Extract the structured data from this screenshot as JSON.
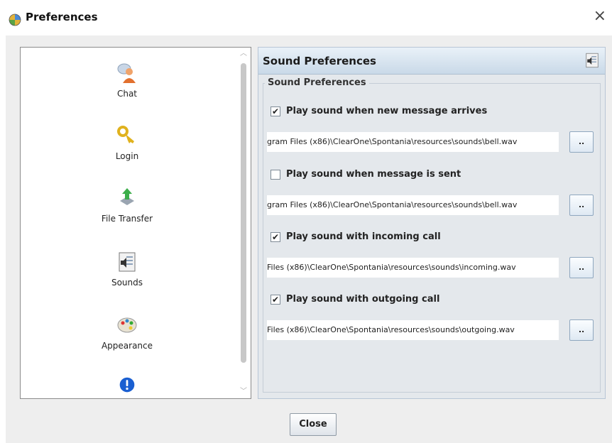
{
  "window": {
    "title": "Preferences",
    "close_glyph": "×"
  },
  "sidebar": {
    "items": [
      {
        "label": "Chat",
        "icon": "chat-user-icon"
      },
      {
        "label": "Login",
        "icon": "key-icon"
      },
      {
        "label": "File Transfer",
        "icon": "file-transfer-icon"
      },
      {
        "label": "Sounds",
        "icon": "sounds-icon"
      },
      {
        "label": "Appearance",
        "icon": "palette-icon"
      },
      {
        "label": "",
        "icon": "info-icon"
      }
    ]
  },
  "panel": {
    "header_title": "Sound Preferences",
    "group_title": "Sound Preferences",
    "options": [
      {
        "label": "Play sound when new message arrives",
        "checked": true,
        "path": "gram Files (x86)\\ClearOne\\Spontania\\resources\\sounds\\bell.wav",
        "browse": ".."
      },
      {
        "label": "Play sound when message is sent",
        "checked": false,
        "path": "gram Files (x86)\\ClearOne\\Spontania\\resources\\sounds\\bell.wav",
        "browse": ".."
      },
      {
        "label": "Play sound with incoming call",
        "checked": true,
        "path": "Files (x86)\\ClearOne\\Spontania\\resources\\sounds\\incoming.wav",
        "browse": ".."
      },
      {
        "label": "Play sound with outgoing call",
        "checked": true,
        "path": "Files (x86)\\ClearOne\\Spontania\\resources\\sounds\\outgoing.wav",
        "browse": ".."
      }
    ]
  },
  "footer": {
    "close_label": "Close"
  },
  "colors": {
    "panel_header": "#c9d9e8",
    "panel_bg": "#e4e8ec",
    "accent_blue": "#1a5fd1"
  }
}
